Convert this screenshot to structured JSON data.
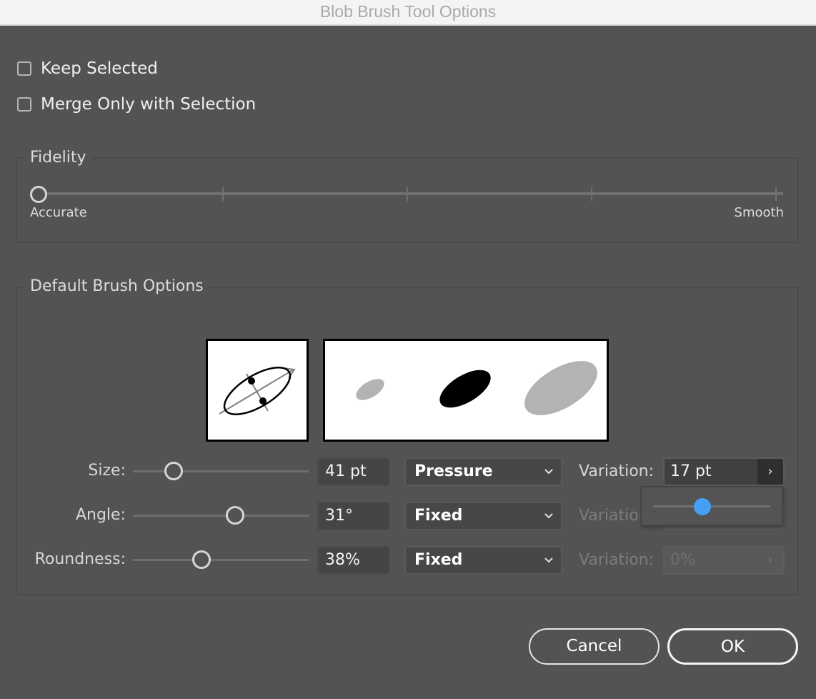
{
  "window": {
    "title": "Blob Brush Tool Options"
  },
  "options": {
    "keep_selected": {
      "label": "Keep Selected",
      "checked": false
    },
    "merge_only_with_selection": {
      "label": "Merge Only with Selection",
      "checked": false
    }
  },
  "fidelity": {
    "title": "Fidelity",
    "min_label": "Accurate",
    "max_label": "Smooth",
    "value_fraction": 0,
    "tick_count": 5
  },
  "brush": {
    "title": "Default Brush Options",
    "rows": [
      {
        "label": "Size:",
        "value": "41 pt",
        "slider_fraction": 0.23,
        "mode": "Pressure",
        "variation_label": "Variation:",
        "variation_value": "17 pt",
        "variation_enabled": true
      },
      {
        "label": "Angle:",
        "value": "31°",
        "slider_fraction": 0.58,
        "mode": "Fixed",
        "variation_label": "Variation:",
        "variation_value": "",
        "variation_enabled": false
      },
      {
        "label": "Roundness:",
        "value": "38%",
        "slider_fraction": 0.39,
        "mode": "Fixed",
        "variation_label": "Variation:",
        "variation_value": "0%",
        "variation_enabled": false
      }
    ],
    "variation_popover": {
      "slider_fraction": 0.42,
      "accent": "#45a0f5"
    }
  },
  "icons": {
    "chevron_down": "⌵",
    "chevron_right": "›"
  },
  "buttons": {
    "cancel": "Cancel",
    "ok": "OK"
  }
}
